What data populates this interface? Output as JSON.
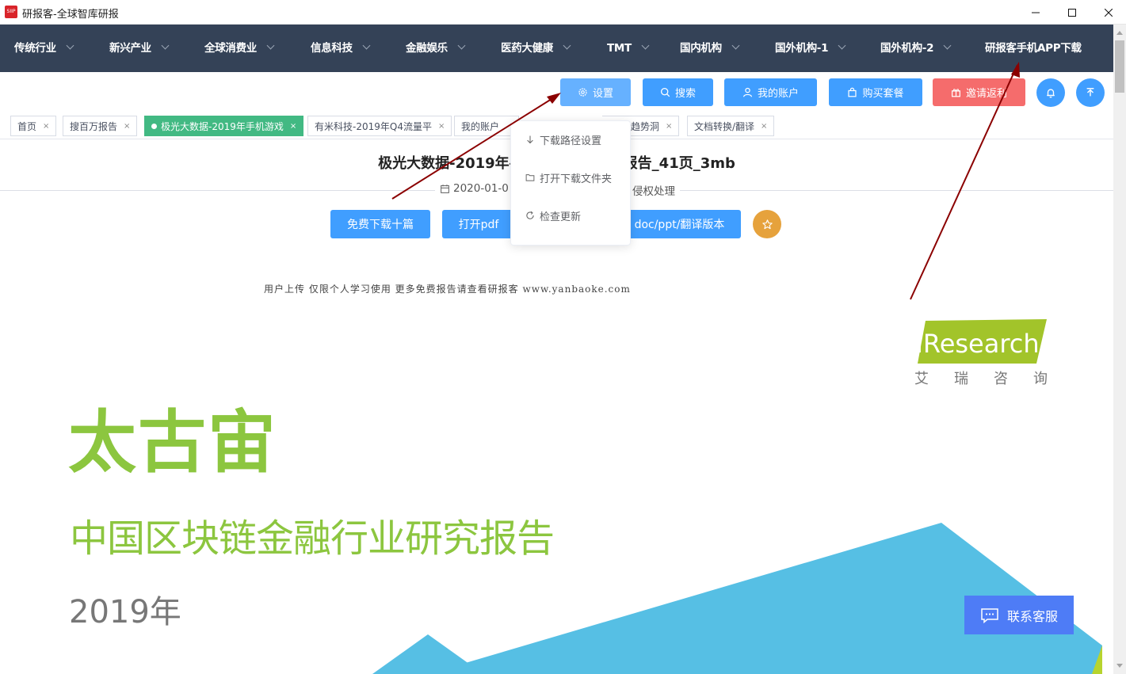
{
  "window": {
    "app_icon_text": "SIIP",
    "title": "研报客-全球智库研报"
  },
  "nav": {
    "items": [
      {
        "label": "传统行业",
        "has_dropdown": true
      },
      {
        "label": "新兴产业",
        "has_dropdown": true
      },
      {
        "label": "全球消费业",
        "has_dropdown": true
      },
      {
        "label": "信息科技",
        "has_dropdown": true
      },
      {
        "label": "金融娱乐",
        "has_dropdown": true
      },
      {
        "label": "医药大健康",
        "has_dropdown": true
      },
      {
        "label": "TMT",
        "has_dropdown": true
      },
      {
        "label": "国内机构",
        "has_dropdown": true
      },
      {
        "label": "国外机构-1",
        "has_dropdown": true
      },
      {
        "label": "国外机构-2",
        "has_dropdown": true
      },
      {
        "label": "研报客手机APP下载",
        "has_dropdown": false
      }
    ]
  },
  "toolbar": {
    "settings": "设置",
    "search": "搜索",
    "account": "我的账户",
    "buy": "购买套餐",
    "invite": "邀请返利"
  },
  "tabs": [
    {
      "label": "首页",
      "active": false
    },
    {
      "label": "搜百万报告",
      "active": false
    },
    {
      "label": "极光大数据-2019年手机游戏",
      "active": true
    },
    {
      "label": "有米科技-2019年Q4流量平",
      "active": false
    },
    {
      "label": "我的账户",
      "active": false
    },
    {
      "label": "趋势洞",
      "active": false
    },
    {
      "label": "文档转换/翻译",
      "active": false
    }
  ],
  "document": {
    "title": "极光大数据-2019年手机游戏行业研究报告_41页_3mb",
    "date": "2020-01-0",
    "rights": "侵权处理",
    "actions": {
      "free_download": "免费下载十篇",
      "open_pdf": "打开pdf",
      "doc_version": "doc/ppt/翻译版本"
    }
  },
  "settings_menu": {
    "items": [
      {
        "label": "下载路径设置",
        "icon": "arrow-down-icon"
      },
      {
        "label": "打开下载文件夹",
        "icon": "folder-icon"
      },
      {
        "label": "检查更新",
        "icon": "refresh-icon"
      }
    ]
  },
  "content": {
    "watermark": "用户上传 仅限个人学习使用 更多免费报告请查看研报客 www.yanbaoke.com",
    "logo_text": "iResearch",
    "logo_sub": [
      "艾",
      "瑞",
      "咨",
      "询"
    ],
    "big_title": "太古宙",
    "subtitle": "中国区块链金融行业研究报告",
    "year": "2019年"
  },
  "customer_service": "联系客服",
  "colors": {
    "nav_bg": "#344257",
    "primary": "#409eff",
    "danger": "#f56c6c",
    "tab_active": "#42b983",
    "star": "#e6a23c",
    "brand_green": "#8cc63f",
    "annotation_arrow": "#8b0000"
  }
}
